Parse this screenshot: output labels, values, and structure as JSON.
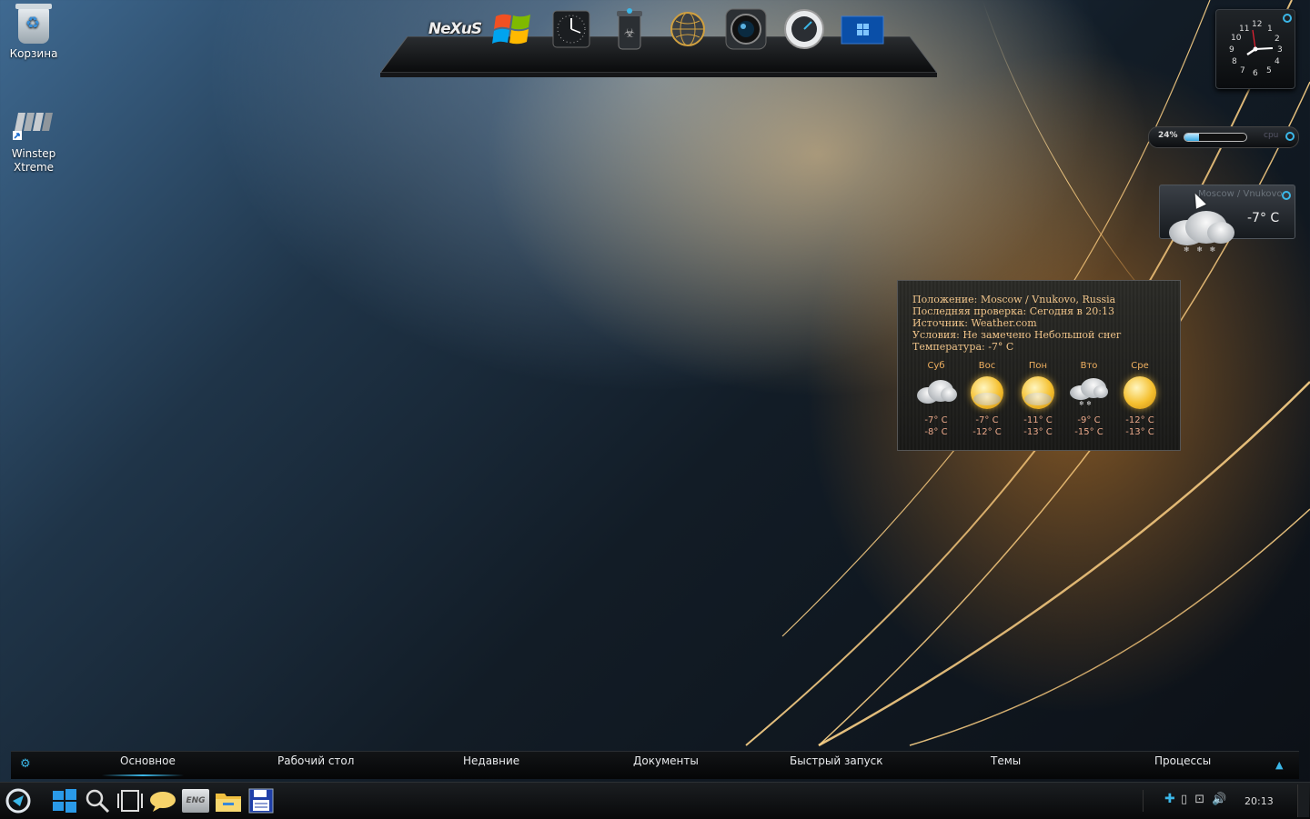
{
  "desktop": {
    "icons": [
      {
        "label": "Корзина",
        "icon": "recycle-bin-icon"
      },
      {
        "label": "Winstep Xtreme",
        "icon": "winstep-icon"
      }
    ]
  },
  "dock": {
    "items": [
      {
        "label": "NeXuS",
        "icon": "nexus-logo-icon"
      },
      {
        "icon": "windows-flag-icon"
      },
      {
        "icon": "clock-app-icon"
      },
      {
        "icon": "biohazard-bin-icon"
      },
      {
        "icon": "globe-network-icon"
      },
      {
        "icon": "camera-lens-icon"
      },
      {
        "icon": "speedometer-icon"
      },
      {
        "icon": "windows-desktop-icon"
      }
    ]
  },
  "clock_gadget": {
    "numbers": [
      "12",
      "1",
      "2",
      "3",
      "4",
      "5",
      "6",
      "7",
      "8",
      "9",
      "10",
      "11"
    ]
  },
  "cpu_meter": {
    "percent_label": "24%",
    "value": 24,
    "label": "cpu"
  },
  "weather_small": {
    "location": "Moscow / Vnukovo",
    "temperature": "-7° C"
  },
  "weather_detail": {
    "location_line": "Положение: Moscow / Vnukovo, Russia",
    "checked_line": "Последняя проверка: Сегодня в 20:13",
    "source_line": "Источник: Weather.com",
    "conditions_line": "Условия: Не замечено Небольшой снег",
    "temperature_line": "Температура: -7° C",
    "forecast": [
      {
        "day": "Суб",
        "high": "-7° C",
        "low": "-8° C",
        "icon": "cloudy-icon"
      },
      {
        "day": "Вос",
        "high": "-7° C",
        "low": "-12° C",
        "icon": "partly-sunny-icon"
      },
      {
        "day": "Пон",
        "high": "-11° C",
        "low": "-13° C",
        "icon": "partly-sunny-icon"
      },
      {
        "day": "Вто",
        "high": "-9° C",
        "low": "-15° C",
        "icon": "snow-icon"
      },
      {
        "day": "Сре",
        "high": "-12° C",
        "low": "-13° C",
        "icon": "sunny-icon"
      }
    ]
  },
  "menubar": {
    "tabs": [
      {
        "label": "Основное",
        "active": true
      },
      {
        "label": "Рабочий стол"
      },
      {
        "label": "Недавние"
      },
      {
        "label": "Документы"
      },
      {
        "label": "Быстрый запуск"
      },
      {
        "label": "Темы"
      },
      {
        "label": "Процессы"
      }
    ]
  },
  "taskbar": {
    "lang_label": "ENG",
    "time": "20:13",
    "accent": "#3bb7e8"
  }
}
